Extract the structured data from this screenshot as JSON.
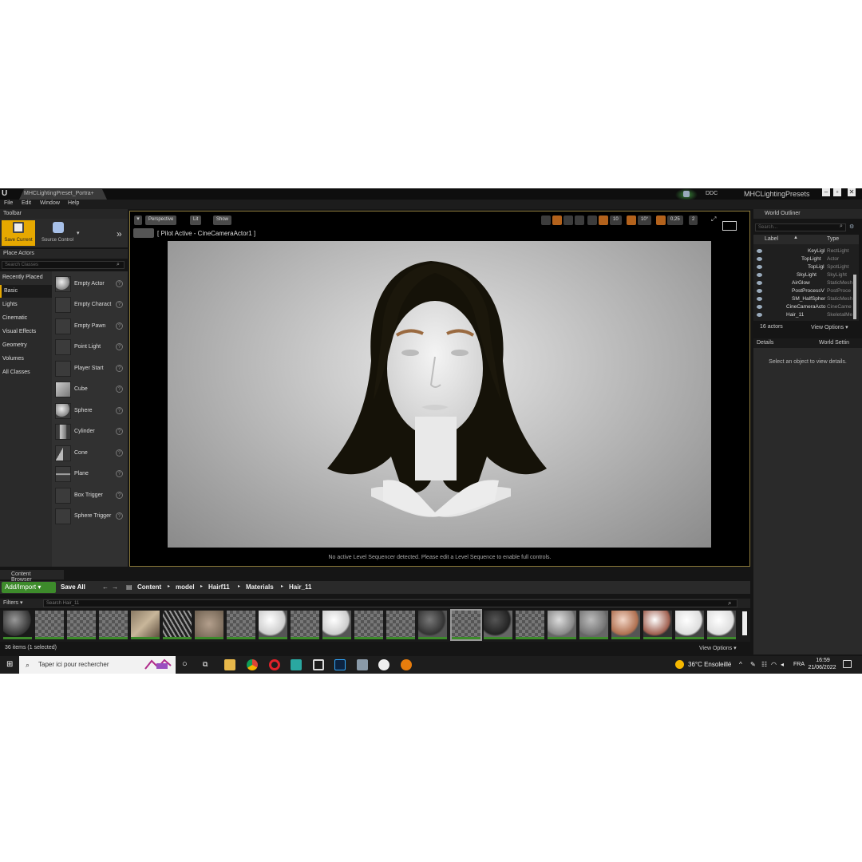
{
  "window": {
    "document_tab": "MHCLightingPreset_Portra+",
    "ddc_label": "DDC",
    "project_name": "MHCLightingPresets"
  },
  "menu": [
    "File",
    "Edit",
    "Window",
    "Help"
  ],
  "toolbar": {
    "tab_label": "Toolbar",
    "save_label": "Save Current",
    "source_control_label": "Source Control"
  },
  "place_actors": {
    "tab_label": "Place Actors",
    "search_placeholder": "Search Classes",
    "categories": [
      "Recently Placed",
      "Basic",
      "Lights",
      "Cinematic",
      "Visual Effects",
      "Geometry",
      "Volumes",
      "All Classes"
    ],
    "active_category": "Basic",
    "actors": [
      "Empty Actor",
      "Empty Charact",
      "Empty Pawn",
      "Point Light",
      "Player Start",
      "Cube",
      "Sphere",
      "Cylinder",
      "Cone",
      "Plane",
      "Box Trigger",
      "Sphere Trigger"
    ]
  },
  "viewport": {
    "perspective_label": "Perspective",
    "lit_label": "Lit",
    "show_label": "Show",
    "pilot_label": "[ Pilot Active - CineCameraActor1 ]",
    "grid_snap": "10",
    "rotation_snap": "10°",
    "scale_snap": "0,25",
    "camera_speed": "2",
    "sequencer_message": "No active Level Sequencer detected. Please edit a Level Sequence to enable full controls."
  },
  "world_outliner": {
    "tab_label": "World Outliner",
    "search_placeholder": "Search...",
    "col_label": "Label",
    "col_type": "Type",
    "rows": [
      {
        "label": "KeyLigl",
        "type": "RectLight"
      },
      {
        "label": "TopLight",
        "type": "Actor"
      },
      {
        "label": "TopLigl",
        "type": "SpotLight"
      },
      {
        "label": "SkyLight",
        "type": "SkyLight"
      },
      {
        "label": "AirGlow",
        "type": "StaticMesh"
      },
      {
        "label": "PostProcessV",
        "type": "PostProce"
      },
      {
        "label": "SM_HalfSpher",
        "type": "StaticMesh"
      },
      {
        "label": "CineCameraActo",
        "type": "CineCame"
      },
      {
        "label": "Hair_11",
        "type": "SkeletalMe"
      }
    ],
    "actor_count": "16 actors",
    "view_options": "View Options"
  },
  "details": {
    "tab_details": "Details",
    "tab_world_settings": "World Settin",
    "empty_message": "Select an object to view details."
  },
  "content_browser": {
    "tab_label": "Content Browser",
    "add_import": "Add/Import",
    "save_all": "Save All",
    "breadcrumbs": [
      "Content",
      "model",
      "Hairf11",
      "Materials",
      "Hair_11"
    ],
    "filters_label": "Filters",
    "search_placeholder": "Search Hair_11",
    "item_count": "36 items (1 selected)",
    "view_options": "View Options",
    "asset_count_visible": 23
  },
  "taskbar": {
    "search_placeholder": "Taper ici pour rechercher",
    "weather": "36°C  Ensoleillé",
    "language": "FRA",
    "time": "16:59",
    "date": "21/06/2022"
  },
  "colors": {
    "accent_orange": "#e6a800",
    "add_import_green": "#3d8b2b",
    "viewport_border": "#8c7a3a"
  }
}
